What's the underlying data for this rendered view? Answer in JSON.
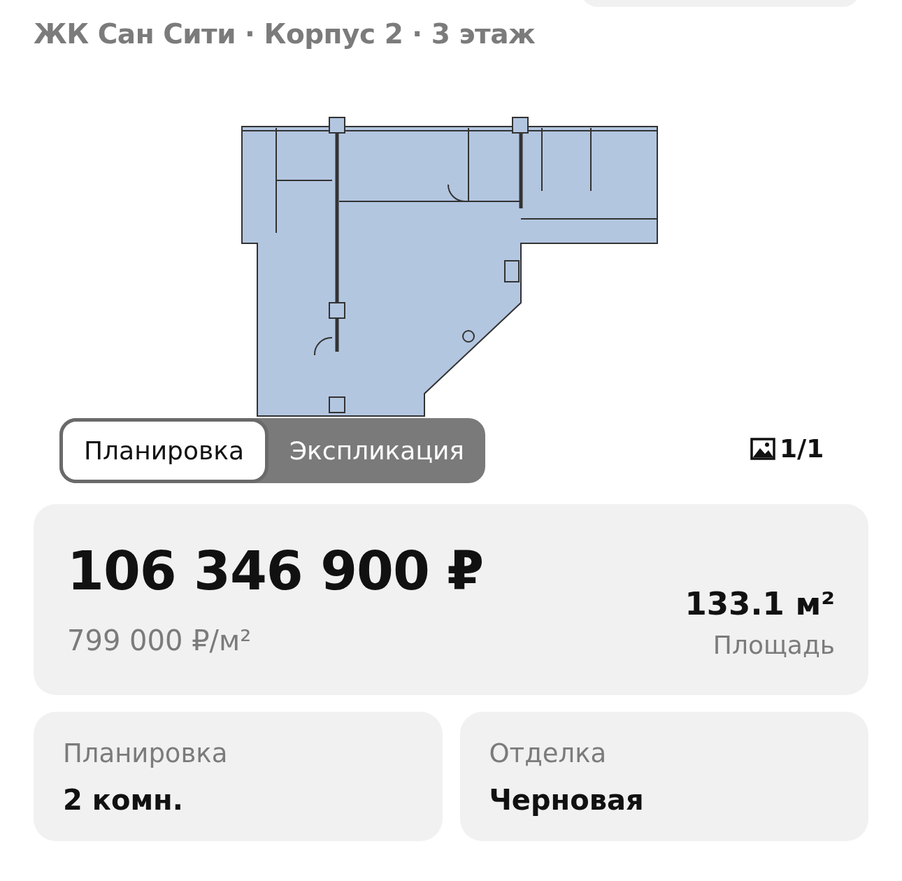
{
  "title": "ЖК Сан Сити · Корпус 2 · 3 этаж",
  "plan_tabs": [
    {
      "label": "Планировка",
      "selected": true
    },
    {
      "label": "Экспликация",
      "selected": false
    }
  ],
  "photo_counter": "1/1",
  "price": {
    "total": "106 346 900 ₽",
    "per_meter": "799 000 ₽/м²",
    "area": "133.1 м²",
    "area_label": "Площадь"
  },
  "details": [
    {
      "label": "Планировка",
      "value": "2 комн."
    },
    {
      "label": "Отделка",
      "value": "Черновая"
    }
  ]
}
